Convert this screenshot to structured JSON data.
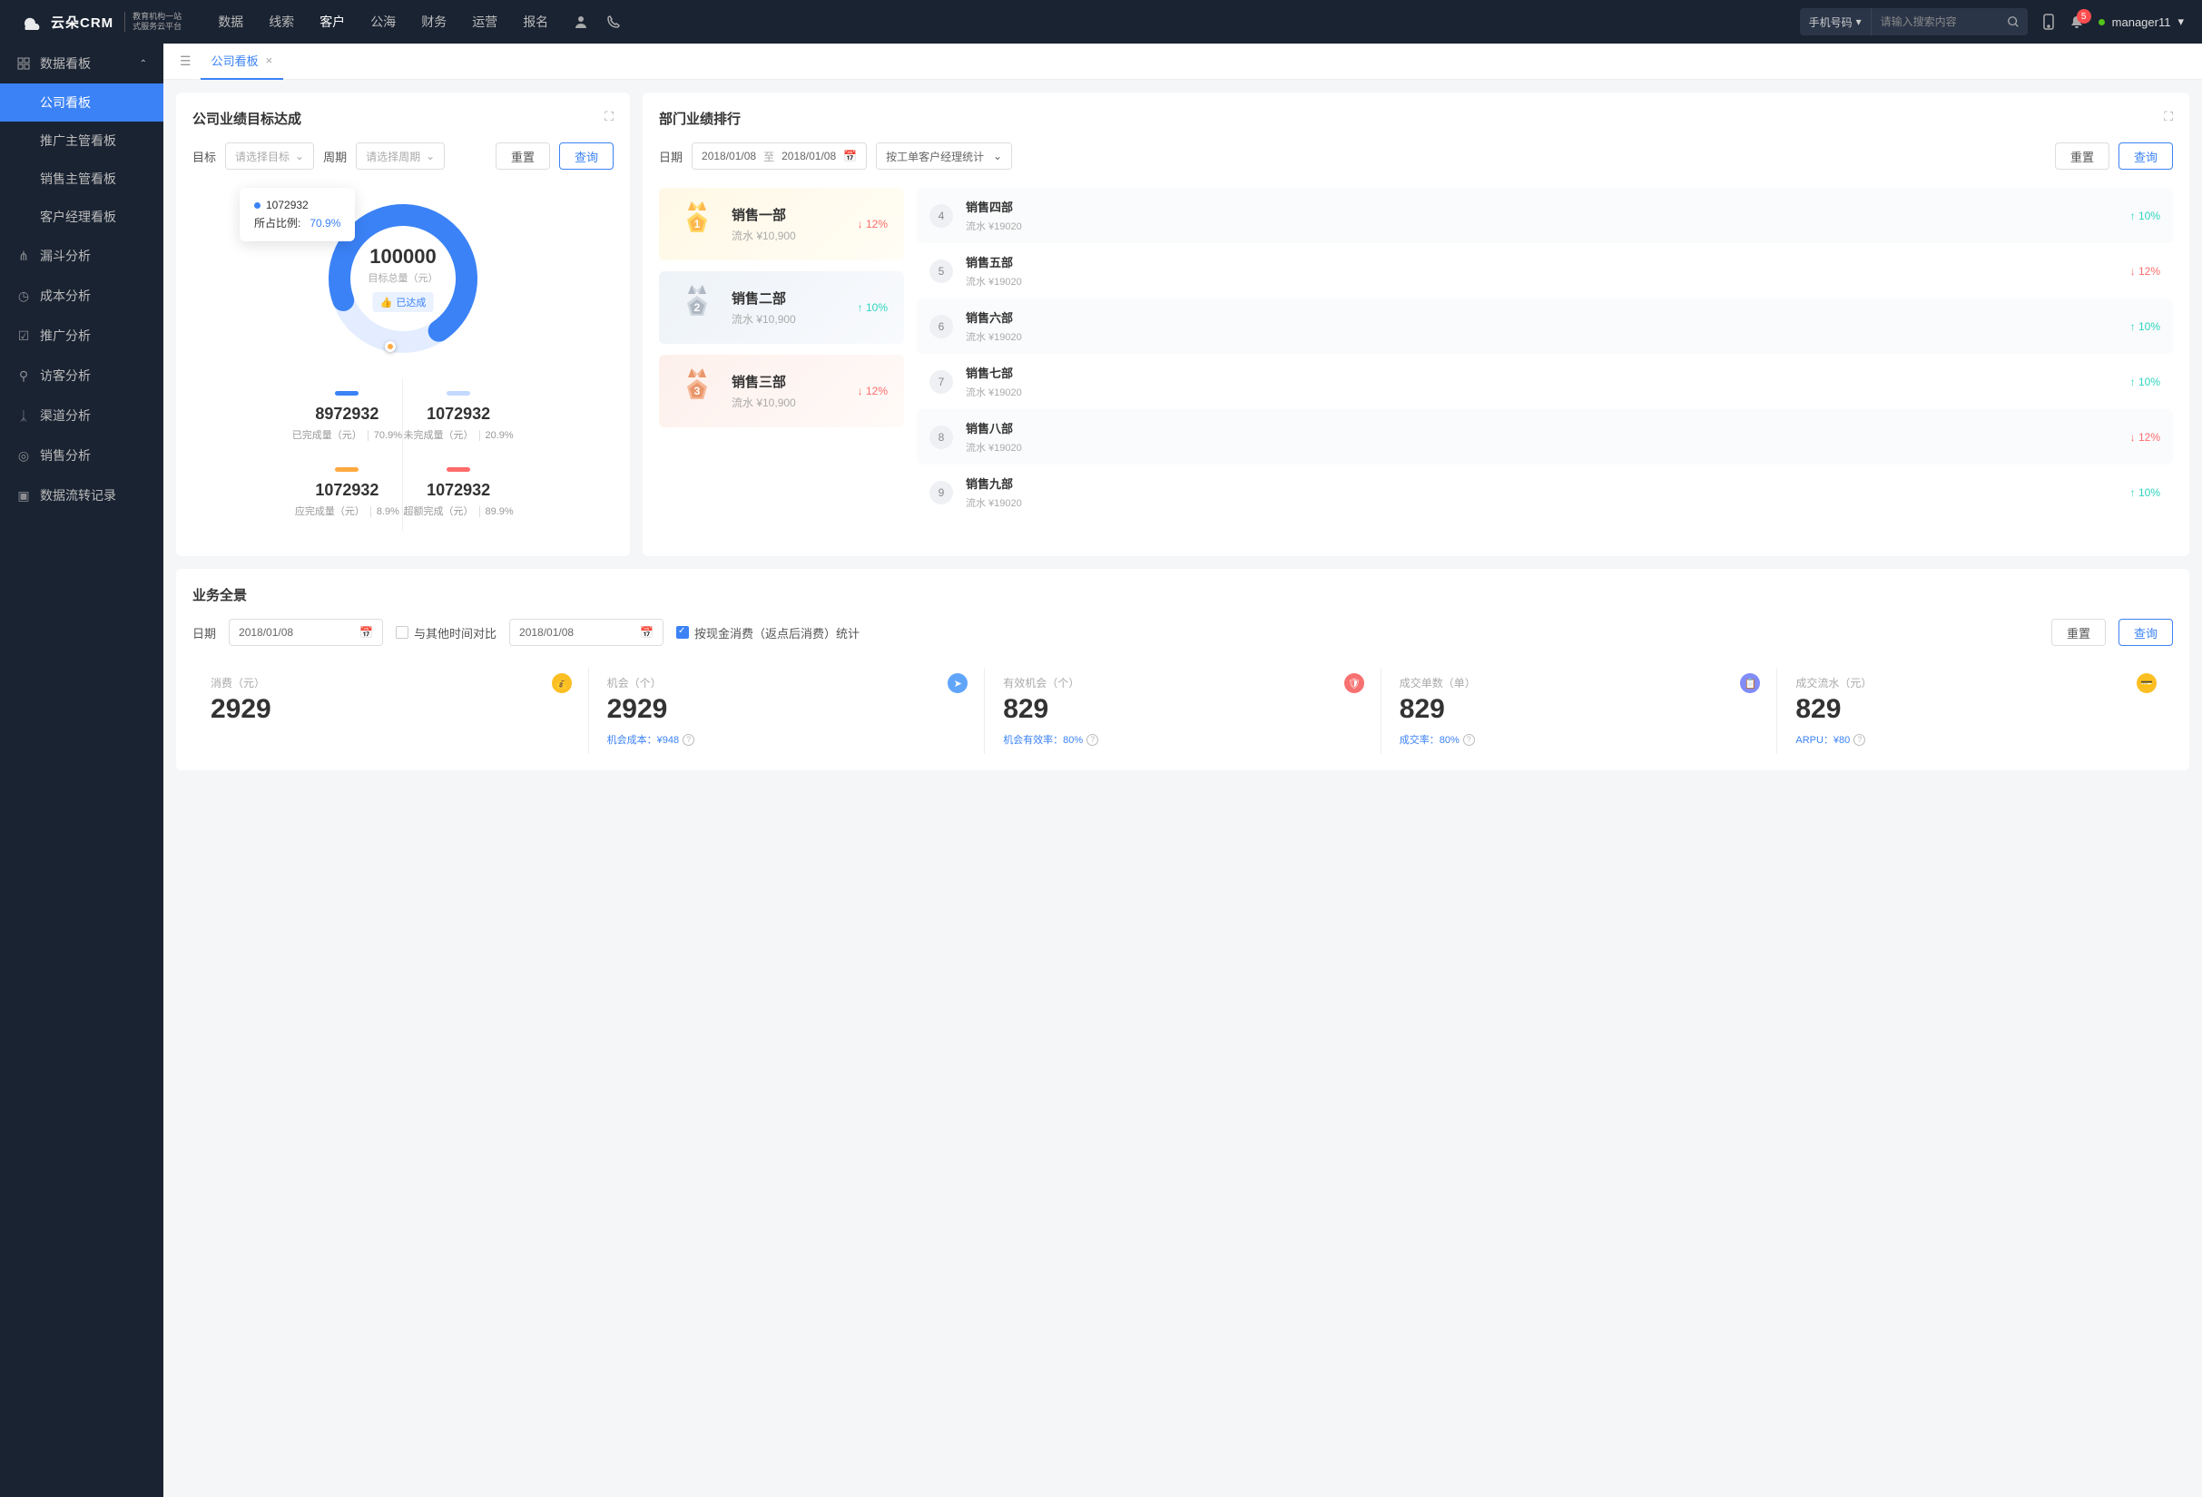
{
  "header": {
    "logo_brand": "云朵CRM",
    "logo_sub1": "教育机构一站",
    "logo_sub2": "式服务云平台",
    "nav": [
      "数据",
      "线索",
      "客户",
      "公海",
      "财务",
      "运营",
      "报名"
    ],
    "nav_active_idx": 2,
    "search_type": "手机号码",
    "search_placeholder": "请输入搜索内容",
    "notif_count": "5",
    "user": "manager11"
  },
  "sidebar": {
    "group_head": "数据看板",
    "group_items": [
      "公司看板",
      "推广主管看板",
      "销售主管看板",
      "客户经理看板"
    ],
    "group_active_idx": 0,
    "singles": [
      "漏斗分析",
      "成本分析",
      "推广分析",
      "访客分析",
      "渠道分析",
      "销售分析",
      "数据流转记录"
    ]
  },
  "tabs": {
    "active": "公司看板"
  },
  "goal_card": {
    "title": "公司业绩目标达成",
    "label_target": "目标",
    "ph_target": "请选择目标",
    "label_period": "周期",
    "ph_period": "请选择周期",
    "btn_reset": "重置",
    "btn_query": "查询",
    "tooltip_val": "1072932",
    "tooltip_lbl": "所占比例:",
    "tooltip_pct": "70.9%",
    "center_val": "100000",
    "center_lbl": "目标总量（元）",
    "center_tag": "已达成",
    "stats": [
      {
        "bar": "#3b82f6",
        "num": "8972932",
        "desc": "已完成量（元）",
        "pct": "70.9%"
      },
      {
        "bar": "#c3d9ff",
        "num": "1072932",
        "desc": "未完成量（元）",
        "pct": "20.9%"
      },
      {
        "bar": "#ffa940",
        "num": "1072932",
        "desc": "应完成量（元）",
        "pct": "8.9%"
      },
      {
        "bar": "#ff6b6b",
        "num": "1072932",
        "desc": "超额完成（元）",
        "pct": "89.9%"
      }
    ]
  },
  "chart_data": {
    "type": "pie",
    "title": "公司业绩目标达成",
    "total_label": "目标总量（元）",
    "total_value": 100000,
    "series": [
      {
        "name": "已完成量（元）",
        "value": 8972932,
        "percent": 70.9,
        "color": "#3b82f6"
      },
      {
        "name": "未完成量（元）",
        "value": 1072932,
        "percent": 20.9,
        "color": "#c3d9ff"
      },
      {
        "name": "应完成量（元）",
        "value": 1072932,
        "percent": 8.9,
        "color": "#ffa940"
      },
      {
        "name": "超额完成（元）",
        "value": 1072932,
        "percent": 89.9,
        "color": "#ff6b6b"
      }
    ],
    "tooltip": {
      "value": 1072932,
      "label": "所占比例:",
      "percent": 70.9
    }
  },
  "rank_card": {
    "title": "部门业绩排行",
    "label_date": "日期",
    "date_from": "2018/01/08",
    "date_to": "2018/01/08",
    "date_sep": "至",
    "stat_by": "按工单客户经理统计",
    "btn_reset": "重置",
    "btn_query": "查询",
    "top": [
      {
        "name": "销售一部",
        "sub": "流水 ¥10,900",
        "delta": "12%",
        "dir": "down"
      },
      {
        "name": "销售二部",
        "sub": "流水 ¥10,900",
        "delta": "10%",
        "dir": "up"
      },
      {
        "name": "销售三部",
        "sub": "流水 ¥10,900",
        "delta": "12%",
        "dir": "down"
      }
    ],
    "list": [
      {
        "no": "4",
        "name": "销售四部",
        "sub": "流水 ¥19020",
        "delta": "10%",
        "dir": "up"
      },
      {
        "no": "5",
        "name": "销售五部",
        "sub": "流水 ¥19020",
        "delta": "12%",
        "dir": "down"
      },
      {
        "no": "6",
        "name": "销售六部",
        "sub": "流水 ¥19020",
        "delta": "10%",
        "dir": "up"
      },
      {
        "no": "7",
        "name": "销售七部",
        "sub": "流水 ¥19020",
        "delta": "10%",
        "dir": "up"
      },
      {
        "no": "8",
        "name": "销售八部",
        "sub": "流水 ¥19020",
        "delta": "12%",
        "dir": "down"
      },
      {
        "no": "9",
        "name": "销售九部",
        "sub": "流水 ¥19020",
        "delta": "10%",
        "dir": "up"
      }
    ]
  },
  "biz_card": {
    "title": "业务全景",
    "label_date": "日期",
    "date1": "2018/01/08",
    "compare_label": "与其他时间对比",
    "date2": "2018/01/08",
    "checkbox_label": "按现金消费（返点后消费）统计",
    "btn_reset": "重置",
    "btn_query": "查询",
    "cells": [
      {
        "label": "消费（元）",
        "val": "2929",
        "foot": "",
        "icon": "#fbbf24"
      },
      {
        "label": "机会（个）",
        "val": "2929",
        "foot": "机会成本：¥948",
        "icon": "#60a5fa"
      },
      {
        "label": "有效机会（个）",
        "val": "829",
        "foot": "机会有效率：80%",
        "icon": "#f87171"
      },
      {
        "label": "成交单数（单）",
        "val": "829",
        "foot": "成交率：80%",
        "icon": "#818cf8"
      },
      {
        "label": "成交流水（元）",
        "val": "829",
        "foot": "ARPU：¥80",
        "icon": "#fbbf24"
      }
    ]
  }
}
